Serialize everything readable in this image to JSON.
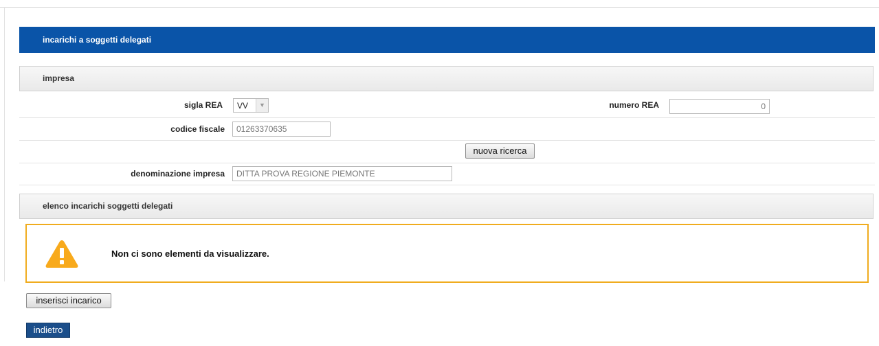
{
  "page": {
    "title": "incarichi a soggetti delegati"
  },
  "impresa": {
    "section_title": "impresa",
    "sigla_rea_label": "sigla REA",
    "sigla_rea_value": "VV",
    "numero_rea_label": "numero REA",
    "numero_rea_value": "0",
    "codice_fiscale_label": "codice fiscale",
    "codice_fiscale_value": "01263370635",
    "nuova_ricerca_label": "nuova ricerca",
    "denominazione_label": "denominazione impresa",
    "denominazione_value": "DITTA PROVA REGIONE PIEMONTE"
  },
  "elenco": {
    "section_title": "elenco incarichi soggetti delegati",
    "empty_message": "Non ci sono elementi da visualizzare.",
    "warning_color": "#f0ac1e"
  },
  "actions": {
    "inserisci_label": "inserisci incarico",
    "indietro_label": "indietro"
  },
  "icons": {
    "warning": "warning-icon",
    "dropdown": "chevron-down-icon"
  },
  "colors": {
    "header_blue": "#0a54a8",
    "primary_button": "#1b4e8a"
  }
}
